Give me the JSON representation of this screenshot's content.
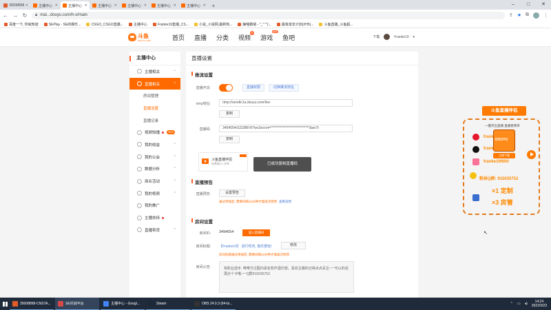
{
  "browser": {
    "tabs": [
      {
        "label": "35008898-CNST...",
        "color": "#e25b2a"
      },
      {
        "label": "主播中心",
        "color": "#ff6a00"
      },
      {
        "label": "主播中心",
        "color": "#ff6a00"
      },
      {
        "label": "主播中心",
        "color": "#ff6a00"
      },
      {
        "label": "主播中心",
        "color": "#ff6a00"
      },
      {
        "label": "主播中心",
        "color": "#ff6a00"
      },
      {
        "label": "主播中心",
        "color": "#ff6a00"
      }
    ],
    "url": "mai...douyu.com/h-x/main",
    "bookmarks": [
      "百度一下, 你就知道",
      "SEPlay - SE的娱乐...",
      "CSGO_CSGO直播...",
      "主播中心",
      "Franke19直播_CS...",
      "小说_小说网,最新热...",
      "静喵鹅绒 - \"_\" \"\"(...",
      "最有成长计划(2H5)...",
      "斗鱼直播_斗鱼超..."
    ]
  },
  "site": {
    "logo_text": "斗鱼",
    "logo_sub": "DOUYU.COM",
    "nav": [
      {
        "label": "首页"
      },
      {
        "label": "直播"
      },
      {
        "label": "分类"
      },
      {
        "label": "视频",
        "badge": "N"
      },
      {
        "label": "游戏",
        "badge": "NEW"
      },
      {
        "label": "鱼吧"
      }
    ],
    "download": "下载",
    "username": "Franke19"
  },
  "sidebar": {
    "title": "主播中心",
    "items": [
      {
        "label": "主播相关",
        "arrow": "^"
      },
      {
        "label": "直播相关",
        "arrow": "^",
        "selected": true
      },
      {
        "label": "房间管理",
        "sub": true
      },
      {
        "label": "直播设置",
        "sub": true,
        "active": true
      },
      {
        "label": "直播记录",
        "sub": true
      },
      {
        "label": "视频知播",
        "badge": "NEW",
        "dot": true
      },
      {
        "label": "我的收益",
        "arrow": "^"
      },
      {
        "label": "我的公会",
        "arrow": "^"
      },
      {
        "label": "数据分析",
        "arrow": "^"
      },
      {
        "label": "商业活动",
        "arrow": "^"
      },
      {
        "label": "我的视频",
        "arrow": "^"
      },
      {
        "label": "我的推广"
      },
      {
        "label": "主播扶持",
        "dot": true
      },
      {
        "label": "直播带货",
        "arrow": "^"
      }
    ]
  },
  "main": {
    "page_title": "直播设置",
    "push": {
      "section": "推流设置",
      "switch_label": "直播开关:",
      "btn1": "直播权限",
      "btn2": "切换推流地址",
      "rtmp_label": "rtmp地址:",
      "rtmp_value": "rtmp://sendtc1a.douyu.com/live",
      "copy": "复制",
      "code_label": "直播码:",
      "code_value": "3494554rS218BIV6?wsSecret=*****************************&wsTi",
      "copy2": "复制",
      "promo_title": "斗鱼直播伴侣",
      "promo_sub": "仅需请10 分钟...",
      "promo_badge": "NEW"
    },
    "preview": {
      "section": "直播预告",
      "label": "直播预告:",
      "btn": "设置预告",
      "note": "通过审核后, 需要间隔10分钟才能再次修改",
      "link": "查看说明"
    },
    "room": {
      "section": "房间设置",
      "id_label": "房间ID:",
      "id_value": "3494554",
      "enter_btn": "进入直播间",
      "title_label": "房间标题:",
      "title_value": "【Franke19】 进行吃鸡, 俱乐部玩!",
      "edit_btn": "修改",
      "title_note": "房间标题通过审核后, 需要间隔10分钟才能再次修改",
      "notice_label": "房间公告:",
      "notice_text": "有职业选手, 带带方过图内承友软作酒乐部。喜欢主播的记得点点关注~一可以的话再办个卡哦~一Q群915035753"
    },
    "toast": "已成功复制直播码"
  },
  "overlay": {
    "title": "斗鱼直播伴侣",
    "sub": "一键开启直播 直播更简单",
    "line1": "franke19",
    "line2": "franke19",
    "line3": "franke19f600",
    "line4": "粉丝Q群: 915035753",
    "big1": "×1 定制",
    "big2": "×3 房管",
    "download": "立即下载"
  },
  "taskbar": {
    "items": [
      {
        "label": "35008898-CNSTA...",
        "color": "#e25b2a",
        "active": false
      },
      {
        "label": "SE対战平台",
        "color": "#d64a4a",
        "active": true
      },
      {
        "label": "主播中心 - Googl...",
        "color": "#4285f4",
        "active": false
      },
      {
        "label": "Steam",
        "color": "#1b2838",
        "active": false
      },
      {
        "label": "OBS 24.0.3 (64-bi...",
        "color": "#333333",
        "active": false
      }
    ],
    "time": "14:24",
    "date": "2022/3/23"
  },
  "colors": {
    "accent": "#ff6a00",
    "link": "#4a7bd4"
  }
}
